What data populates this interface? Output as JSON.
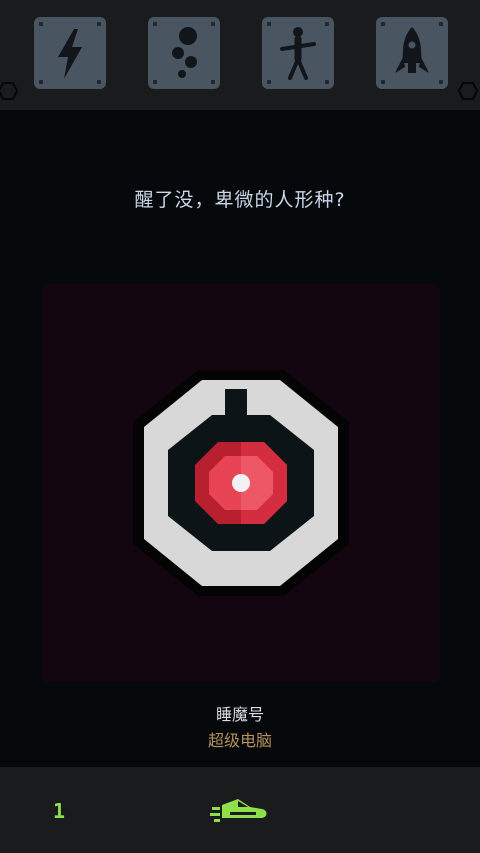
{
  "toolbar": {
    "items": [
      {
        "icon": "lightning-icon",
        "label": ""
      },
      {
        "icon": "bubbles-icon",
        "label": ""
      },
      {
        "icon": "person-icon",
        "label": ""
      },
      {
        "icon": "rocket-icon",
        "label": ""
      }
    ]
  },
  "message": "醒了没，卑微的人形种?",
  "subject": {
    "name": "睡魔号",
    "type": "超级电脑"
  },
  "bottom": {
    "counter": "1",
    "ship_icon": "spaceship-icon"
  },
  "colors": {
    "panel_bg": "#140611",
    "eye_red": "#d42d3f",
    "type_label": "#b5905a",
    "accent_green": "#8fdf4a"
  }
}
